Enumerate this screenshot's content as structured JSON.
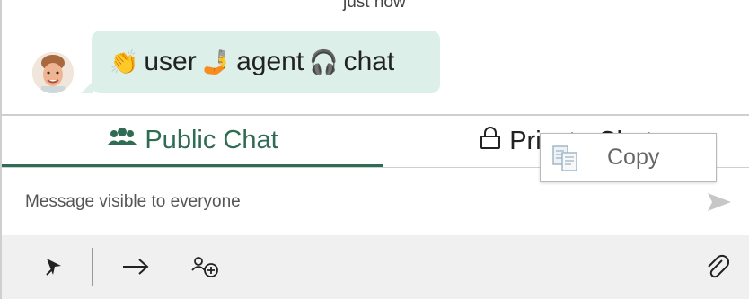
{
  "message": {
    "timestamp": "just now",
    "sender_avatar": "user-avatar",
    "content": {
      "emoji_1": "👏",
      "word_1": "user",
      "emoji_2": "🤳",
      "word_2": "agent",
      "emoji_3": "🎧",
      "word_3": "chat"
    }
  },
  "tabs": [
    {
      "label": "Public Chat",
      "icon": "users-icon",
      "active": true
    },
    {
      "label": "Private Chat",
      "icon": "lock-icon",
      "active": false
    }
  ],
  "composer": {
    "placeholder": "Message visible to everyone",
    "send_icon": "send-icon"
  },
  "toolbar": {
    "items": [
      "pin-icon",
      "arrow-right-icon",
      "add-user-icon",
      "paperclip-icon"
    ]
  },
  "context_menu": {
    "copy_label": "Copy",
    "copy_icon": "copy-icon"
  },
  "colors": {
    "accent": "#2f6c54",
    "bubble_bg": "#dcefe8",
    "toolbar_bg": "#f0f0f0"
  }
}
